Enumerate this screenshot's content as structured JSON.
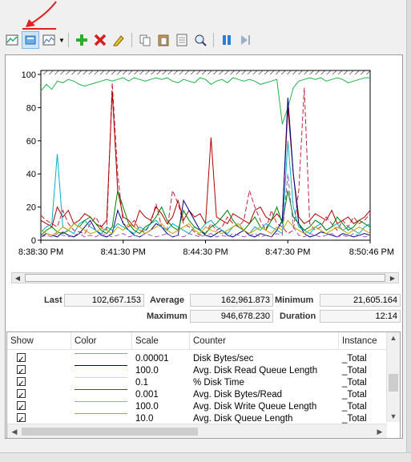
{
  "toolbar": {
    "buttons": [
      {
        "name": "view-current-activity-button",
        "icon": "current-activity-icon"
      },
      {
        "name": "view-log-data-button",
        "icon": "log-data-icon"
      },
      {
        "name": "change-graph-type-button",
        "icon": "graph-type-icon"
      },
      {
        "name": "add-counter-button",
        "icon": "add-icon"
      },
      {
        "name": "delete-counter-button",
        "icon": "delete-icon"
      },
      {
        "name": "highlight-button",
        "icon": "highlight-icon"
      },
      {
        "name": "copy-properties-button",
        "icon": "copy-icon"
      },
      {
        "name": "paste-counter-list-button",
        "icon": "paste-icon"
      },
      {
        "name": "properties-button",
        "icon": "properties-icon"
      },
      {
        "name": "zoom-button",
        "icon": "zoom-icon"
      },
      {
        "name": "freeze-display-button",
        "icon": "pause-icon"
      },
      {
        "name": "update-data-button",
        "icon": "step-icon"
      }
    ],
    "dropdown_arrow": "▼"
  },
  "chart_data": {
    "type": "line",
    "ylim": [
      0,
      100
    ],
    "yticks": [
      "100",
      "80",
      "60",
      "40",
      "20",
      "0"
    ],
    "xticks": [
      "8:38:30 PM",
      "8:41:30 PM",
      "8:44:30 PM",
      "8:47:30 PM",
      "8:50:46 PM"
    ],
    "grid": false,
    "series": [
      {
        "color": "#22b14c",
        "values": [
          90,
          94,
          91,
          96,
          95,
          97,
          96,
          94,
          93,
          94,
          95,
          96,
          97,
          96,
          97,
          98,
          96,
          98,
          97,
          96,
          97,
          98,
          97,
          98,
          96,
          95,
          97,
          96,
          95,
          98,
          97,
          94,
          96,
          97,
          95,
          98,
          97,
          96,
          97,
          96,
          94,
          95,
          96,
          97,
          70,
          80,
          92,
          96,
          97,
          98,
          97,
          98,
          96,
          97,
          98,
          97,
          95,
          96,
          97,
          98,
          98
        ]
      },
      {
        "color": "#c0223c",
        "dash": true,
        "values": [
          15,
          12,
          10,
          8,
          18,
          10,
          6,
          5,
          4,
          10,
          14,
          8,
          6,
          95,
          40,
          10,
          8,
          12,
          6,
          5,
          10,
          22,
          8,
          6,
          30,
          22,
          10,
          8,
          5,
          3,
          4,
          10,
          6,
          8,
          14,
          10,
          8,
          12,
          30,
          20,
          12,
          6,
          18,
          10,
          8,
          4,
          6,
          30,
          92,
          10,
          6,
          8,
          14,
          10,
          6,
          12,
          8,
          14,
          10,
          12,
          16
        ]
      },
      {
        "color": "#b00000",
        "values": [
          12,
          10,
          8,
          20,
          14,
          18,
          10,
          12,
          16,
          14,
          10,
          8,
          12,
          90,
          30,
          14,
          12,
          8,
          18,
          14,
          12,
          20,
          16,
          10,
          14,
          24,
          12,
          18,
          14,
          16,
          10,
          62,
          14,
          12,
          10,
          16,
          14,
          12,
          10,
          18,
          20,
          14,
          12,
          16,
          12,
          80,
          40,
          14,
          10,
          12,
          16,
          14,
          12,
          18,
          10,
          12,
          14,
          10,
          12,
          14,
          18
        ]
      },
      {
        "color": "#000080",
        "values": [
          2,
          4,
          3,
          2,
          5,
          3,
          2,
          4,
          8,
          12,
          6,
          3,
          2,
          4,
          18,
          10,
          6,
          3,
          2,
          4,
          6,
          10,
          8,
          4,
          2,
          3,
          24,
          18,
          12,
          6,
          3,
          2,
          4,
          6,
          3,
          2,
          4,
          6,
          3,
          2,
          4,
          3,
          2,
          6,
          12,
          86,
          40,
          10,
          4,
          2,
          3,
          5,
          4,
          3,
          2,
          4,
          3,
          2,
          3,
          4,
          3
        ]
      },
      {
        "color": "#00b0c8",
        "values": [
          5,
          8,
          10,
          52,
          8,
          6,
          4,
          10,
          12,
          8,
          6,
          4,
          8,
          6,
          10,
          8,
          6,
          4,
          8,
          6,
          10,
          12,
          8,
          6,
          10,
          8,
          6,
          4,
          8,
          6,
          10,
          12,
          8,
          6,
          4,
          8,
          10,
          6,
          4,
          8,
          6,
          10,
          8,
          6,
          4,
          60,
          20,
          8,
          6,
          4,
          8,
          10,
          6,
          8,
          10,
          6,
          8,
          6,
          4,
          8,
          10
        ]
      },
      {
        "color": "#008000",
        "values": [
          3,
          6,
          8,
          5,
          4,
          6,
          10,
          8,
          12,
          14,
          10,
          6,
          4,
          8,
          30,
          20,
          10,
          6,
          4,
          8,
          10,
          14,
          20,
          12,
          8,
          6,
          18,
          12,
          8,
          6,
          4,
          8,
          10,
          14,
          18,
          12,
          8,
          6,
          10,
          14,
          8,
          6,
          12,
          20,
          10,
          30,
          14,
          10,
          6,
          8,
          12,
          10,
          6,
          8,
          14,
          10,
          6,
          8,
          12,
          10,
          8
        ]
      },
      {
        "color": "#c8a000",
        "values": [
          6,
          4,
          3,
          5,
          8,
          6,
          10,
          8,
          6,
          4,
          5,
          7,
          6,
          4,
          8,
          6,
          10,
          8,
          6,
          4,
          6,
          8,
          10,
          6,
          4,
          6,
          8,
          10,
          6,
          4,
          8,
          6,
          5,
          4,
          6,
          8,
          10,
          6,
          4,
          6,
          8,
          6,
          4,
          8,
          6,
          12,
          8,
          6,
          4,
          6,
          8,
          6,
          4,
          6,
          8,
          6,
          4,
          6,
          8,
          6,
          4
        ]
      },
      {
        "color": "#9b59b6",
        "dash": true,
        "values": [
          2,
          3,
          2,
          4,
          3,
          2,
          3,
          4,
          2,
          3,
          2,
          4,
          3,
          2,
          3,
          4,
          2,
          3,
          2,
          4,
          3,
          2,
          3,
          4,
          2,
          3,
          2,
          4,
          3,
          2,
          3,
          4,
          2,
          3,
          2,
          4,
          3,
          2,
          3,
          4,
          2,
          3,
          2,
          4,
          3,
          40,
          8,
          3,
          2,
          4,
          3,
          2,
          3,
          4,
          2,
          3,
          2,
          4,
          3,
          2,
          3
        ]
      }
    ]
  },
  "time_scrollbar": {
    "left_arrow": "◀",
    "right_arrow": "▶"
  },
  "stats": {
    "last_label": "Last",
    "last_value": "102,667.153",
    "average_label": "Average",
    "average_value": "162,961.873",
    "minimum_label": "Minimum",
    "minimum_value": "21,605.164",
    "maximum_label": "Maximum",
    "maximum_value": "946,678.230",
    "duration_label": "Duration",
    "duration_value": "12:14"
  },
  "counter_list": {
    "columns": [
      "Show",
      "Color",
      "Scale",
      "Counter",
      "Instance"
    ],
    "rows": [
      {
        "checked": "✓",
        "color": "#3fb8ff",
        "scale": "0.00001",
        "counter": "Disk Bytes/sec",
        "instance": "_Total"
      },
      {
        "checked": "✓",
        "color": "#000080",
        "scale": "100.0",
        "counter": "Avg. Disk Read Queue Length",
        "instance": "_Total"
      },
      {
        "checked": "✓",
        "color": "#e6d98a",
        "scale": "0.1",
        "counter": "% Disk Time",
        "instance": "_Total"
      },
      {
        "checked": "✓",
        "color": "#008000",
        "scale": "0.001",
        "counter": "Avg. Disk Bytes/Read",
        "instance": "_Total"
      },
      {
        "checked": "✓",
        "color": "#48d1cc",
        "scale": "100.0",
        "counter": "Avg. Disk Write Queue Length",
        "instance": "_Total"
      },
      {
        "checked": "✓",
        "color": "#c8a000",
        "scale": "10.0",
        "counter": "Avg. Disk Queue Length",
        "instance": "_Total"
      }
    ],
    "scroll_up": "▲",
    "scroll_down": "▼",
    "scroll_left": "◀",
    "scroll_right": "▶"
  },
  "annotation": {
    "color": "#e02020"
  }
}
